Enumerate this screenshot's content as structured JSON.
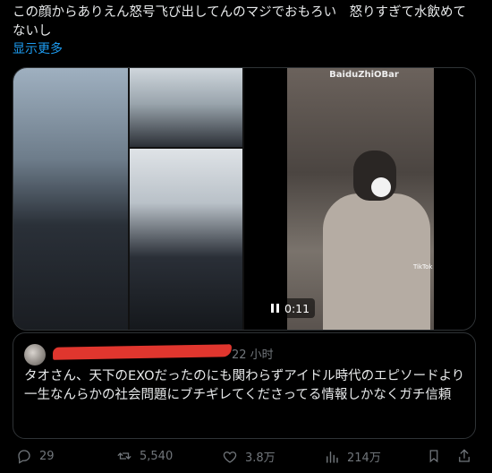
{
  "post": {
    "text": "この顔からありえん怒号飞び出してんのマジでおもろい　怒りすぎて水飲めてないし",
    "show_more": "显示更多"
  },
  "media": {
    "video_watermark": "BaiduZhiOBar",
    "tiktok_label": "TikTok",
    "video_time": "0:11"
  },
  "quote": {
    "time": "22 小时",
    "text": "タオさん、天下のEXOだったのにも関わらずアイドル時代のエピソードより一生なんらかの社会問題にブチギレてくださってる情報しかなくガチ信頼"
  },
  "actions": {
    "replies": "29",
    "reposts": "5,540",
    "likes": "3.8万",
    "views": "214万"
  },
  "colors": {
    "background": "#000000",
    "text": "#e7e9ea",
    "link": "#1d9bf0",
    "muted": "#71767b",
    "border": "#2f3336",
    "redaction": "#e0362e"
  }
}
